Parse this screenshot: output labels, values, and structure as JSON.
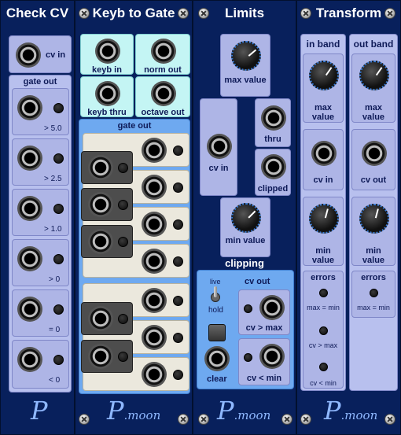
{
  "modules": {
    "check_cv": {
      "title": "Check CV",
      "cv_in_label": "cv in",
      "gate_out_label": "gate out",
      "thresholds": [
        "> 5.0",
        "> 2.5",
        "> 1.0",
        "> 0",
        "= 0",
        "< 0"
      ],
      "logo": "P"
    },
    "keyb_to_gate": {
      "title": "Keyb to Gate",
      "keyb_in_label": "keyb in",
      "norm_out_label": "norm out",
      "keyb_thru_label": "keyb thru",
      "octave_out_label": "octave out",
      "gate_out_label": "gate out",
      "logo_big": "P",
      "logo_small": ".moon"
    },
    "limits": {
      "title": "Limits",
      "max_value_label": "max value",
      "cv_in_label": "cv in",
      "thru_label": "thru",
      "clipped_label": "clipped",
      "min_value_label": "min value",
      "clipping_label": "clipping",
      "live_label": "live",
      "hold_label": "hold",
      "clear_label": "clear",
      "cv_out_label": "cv out",
      "cv_gt_max_label": "cv > max",
      "cv_lt_min_label": "cv < min",
      "logo_big": "P",
      "logo_small": ".moon"
    },
    "transform": {
      "title": "Transform",
      "in_band_label": "in band",
      "out_band_label": "out band",
      "max_value_label": "max value",
      "cv_in_label": "cv in",
      "cv_out_label": "cv out",
      "min_value_label": "min value",
      "errors_label": "errors",
      "max_eq_min_label": "max = min",
      "cv_gt_max_label": "cv > max",
      "cv_lt_min_label": "cv < min",
      "logo_big": "P",
      "logo_small": ".moon"
    }
  },
  "colors": {
    "panel_bg": "#08205c",
    "lavender": "#aeb5e6",
    "cyan": "#c4f5f4",
    "light_blue": "#6ea9f0",
    "cream": "#ebe8dd",
    "knob_ring": "#3a7bd5"
  }
}
